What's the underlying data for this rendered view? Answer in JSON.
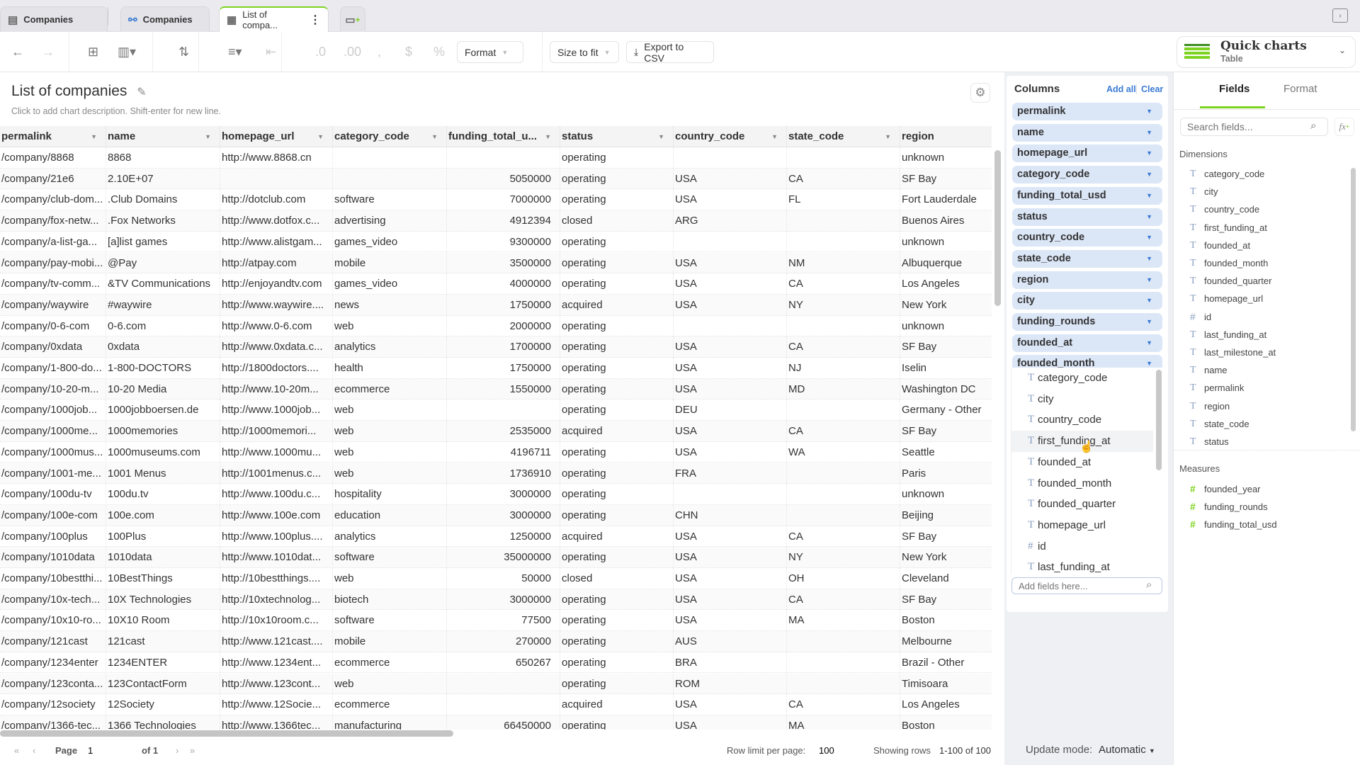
{
  "tabs": [
    {
      "label": "Companies",
      "icon": "dataset-icon"
    },
    {
      "label": "Companies",
      "icon": "model-icon"
    },
    {
      "label": "List of compa...",
      "icon": "table-icon",
      "active": true
    }
  ],
  "toolbar": {
    "format_label": "Format",
    "size_label": "Size to fit",
    "export_label": "Export to CSV"
  },
  "page": {
    "title": "List of companies",
    "subtitle": "Click to add chart description. Shift-enter for new line."
  },
  "table": {
    "columns": [
      "permalink",
      "name",
      "homepage_url",
      "category_code",
      "funding_total_u...",
      "status",
      "country_code",
      "state_code",
      "region"
    ],
    "rows": [
      [
        "/company/8868",
        "8868",
        "http://www.8868.cn",
        "",
        "",
        "operating",
        "",
        "",
        "unknown"
      ],
      [
        "/company/21e6",
        "2.10E+07",
        "",
        "",
        "5050000",
        "operating",
        "USA",
        "CA",
        "SF Bay"
      ],
      [
        "/company/club-dom...",
        ".Club Domains",
        "http://dotclub.com",
        "software",
        "7000000",
        "operating",
        "USA",
        "FL",
        "Fort Lauderdale"
      ],
      [
        "/company/fox-netw...",
        ".Fox Networks",
        "http://www.dotfox.c...",
        "advertising",
        "4912394",
        "closed",
        "ARG",
        "",
        "Buenos Aires"
      ],
      [
        "/company/a-list-ga...",
        "[a]list games",
        "http://www.alistgam...",
        "games_video",
        "9300000",
        "operating",
        "",
        "",
        "unknown"
      ],
      [
        "/company/pay-mobi...",
        "@Pay",
        "http://atpay.com",
        "mobile",
        "3500000",
        "operating",
        "USA",
        "NM",
        "Albuquerque"
      ],
      [
        "/company/tv-comm...",
        "&TV Communications",
        "http://enjoyandtv.com",
        "games_video",
        "4000000",
        "operating",
        "USA",
        "CA",
        "Los Angeles"
      ],
      [
        "/company/waywire",
        "#waywire",
        "http://www.waywire....",
        "news",
        "1750000",
        "acquired",
        "USA",
        "NY",
        "New York"
      ],
      [
        "/company/0-6-com",
        "0-6.com",
        "http://www.0-6.com",
        "web",
        "2000000",
        "operating",
        "",
        "",
        "unknown"
      ],
      [
        "/company/0xdata",
        "0xdata",
        "http://www.0xdata.c...",
        "analytics",
        "1700000",
        "operating",
        "USA",
        "CA",
        "SF Bay"
      ],
      [
        "/company/1-800-do...",
        "1-800-DOCTORS",
        "http://1800doctors....",
        "health",
        "1750000",
        "operating",
        "USA",
        "NJ",
        "Iselin"
      ],
      [
        "/company/10-20-m...",
        "10-20 Media",
        "http://www.10-20m...",
        "ecommerce",
        "1550000",
        "operating",
        "USA",
        "MD",
        "Washington DC"
      ],
      [
        "/company/1000job...",
        "1000jobboersen.de",
        "http://www.1000job...",
        "web",
        "",
        "operating",
        "DEU",
        "",
        "Germany - Other"
      ],
      [
        "/company/1000me...",
        "1000memories",
        "http://1000memori...",
        "web",
        "2535000",
        "acquired",
        "USA",
        "CA",
        "SF Bay"
      ],
      [
        "/company/1000mus...",
        "1000museums.com",
        "http://www.1000mu...",
        "web",
        "4196711",
        "operating",
        "USA",
        "WA",
        "Seattle"
      ],
      [
        "/company/1001-me...",
        "1001 Menus",
        "http://1001menus.c...",
        "web",
        "1736910",
        "operating",
        "FRA",
        "",
        "Paris"
      ],
      [
        "/company/100du-tv",
        "100du.tv",
        "http://www.100du.c...",
        "hospitality",
        "3000000",
        "operating",
        "",
        "",
        "unknown"
      ],
      [
        "/company/100e-com",
        "100e.com",
        "http://www.100e.com",
        "education",
        "3000000",
        "operating",
        "CHN",
        "",
        "Beijing"
      ],
      [
        "/company/100plus",
        "100Plus",
        "http://www.100plus....",
        "analytics",
        "1250000",
        "acquired",
        "USA",
        "CA",
        "SF Bay"
      ],
      [
        "/company/1010data",
        "1010data",
        "http://www.1010dat...",
        "software",
        "35000000",
        "operating",
        "USA",
        "NY",
        "New York"
      ],
      [
        "/company/10bestthi...",
        "10BestThings",
        "http://10bestthings....",
        "web",
        "50000",
        "closed",
        "USA",
        "OH",
        "Cleveland"
      ],
      [
        "/company/10x-tech...",
        "10X Technologies",
        "http://10xtechnolog...",
        "biotech",
        "3000000",
        "operating",
        "USA",
        "CA",
        "SF Bay"
      ],
      [
        "/company/10x10-ro...",
        "10X10 Room",
        "http://10x10room.c...",
        "software",
        "77500",
        "operating",
        "USA",
        "MA",
        "Boston"
      ],
      [
        "/company/121cast",
        "121cast",
        "http://www.121cast....",
        "mobile",
        "270000",
        "operating",
        "AUS",
        "",
        "Melbourne"
      ],
      [
        "/company/1234enter",
        "1234ENTER",
        "http://www.1234ent...",
        "ecommerce",
        "650267",
        "operating",
        "BRA",
        "",
        "Brazil - Other"
      ],
      [
        "/company/123conta...",
        "123ContactForm",
        "http://www.123cont...",
        "web",
        "",
        "operating",
        "ROM",
        "",
        "Timisoara"
      ],
      [
        "/company/12society",
        "12Society",
        "http://www.12Socie...",
        "ecommerce",
        "",
        "acquired",
        "USA",
        "CA",
        "Los Angeles"
      ],
      [
        "/company/1366-tec...",
        "1366 Technologies",
        "http://www.1366tec...",
        "manufacturing",
        "66450000",
        "operating",
        "USA",
        "MA",
        "Boston"
      ]
    ]
  },
  "footer": {
    "page_label": "Page",
    "page_value": "1",
    "of_label": "of 1",
    "row_limit_label": "Row limit per page:",
    "row_limit_value": "100",
    "showing_label": "Showing rows",
    "showing_value": "1-100 of 100"
  },
  "columns_panel": {
    "title": "Columns",
    "add_all": "Add all",
    "clear": "Clear",
    "pills": [
      "permalink",
      "name",
      "homepage_url",
      "category_code",
      "funding_total_usd",
      "status",
      "country_code",
      "state_code",
      "region",
      "city",
      "funding_rounds",
      "founded_at",
      "founded_month"
    ],
    "dropdown": [
      {
        "label": "category_code",
        "type": "T"
      },
      {
        "label": "city",
        "type": "T"
      },
      {
        "label": "country_code",
        "type": "T"
      },
      {
        "label": "first_funding_at",
        "type": "T",
        "hover": true
      },
      {
        "label": "founded_at",
        "type": "T"
      },
      {
        "label": "founded_month",
        "type": "T"
      },
      {
        "label": "founded_quarter",
        "type": "T"
      },
      {
        "label": "homepage_url",
        "type": "T"
      },
      {
        "label": "id",
        "type": "#"
      },
      {
        "label": "last_funding_at",
        "type": "T"
      }
    ],
    "add_placeholder": "Add fields here...",
    "update_mode_label": "Update mode:",
    "update_mode_value": "Automatic"
  },
  "quick_charts": {
    "title": "Quick charts",
    "subtitle": "Table",
    "accent": "#7ed321"
  },
  "fields_panel": {
    "tabs": [
      "Fields",
      "Format"
    ],
    "search_placeholder": "Search fields...",
    "dimensions_label": "Dimensions",
    "dimensions": [
      {
        "label": "category_code",
        "type": "T"
      },
      {
        "label": "city",
        "type": "T"
      },
      {
        "label": "country_code",
        "type": "T"
      },
      {
        "label": "first_funding_at",
        "type": "T"
      },
      {
        "label": "founded_at",
        "type": "T"
      },
      {
        "label": "founded_month",
        "type": "T"
      },
      {
        "label": "founded_quarter",
        "type": "T"
      },
      {
        "label": "homepage_url",
        "type": "T"
      },
      {
        "label": "id",
        "type": "#"
      },
      {
        "label": "last_funding_at",
        "type": "T"
      },
      {
        "label": "last_milestone_at",
        "type": "T"
      },
      {
        "label": "name",
        "type": "T"
      },
      {
        "label": "permalink",
        "type": "T"
      },
      {
        "label": "region",
        "type": "T"
      },
      {
        "label": "state_code",
        "type": "T"
      },
      {
        "label": "status",
        "type": "T"
      }
    ],
    "measures_label": "Measures",
    "measures": [
      "founded_year",
      "funding_rounds",
      "funding_total_usd"
    ]
  }
}
